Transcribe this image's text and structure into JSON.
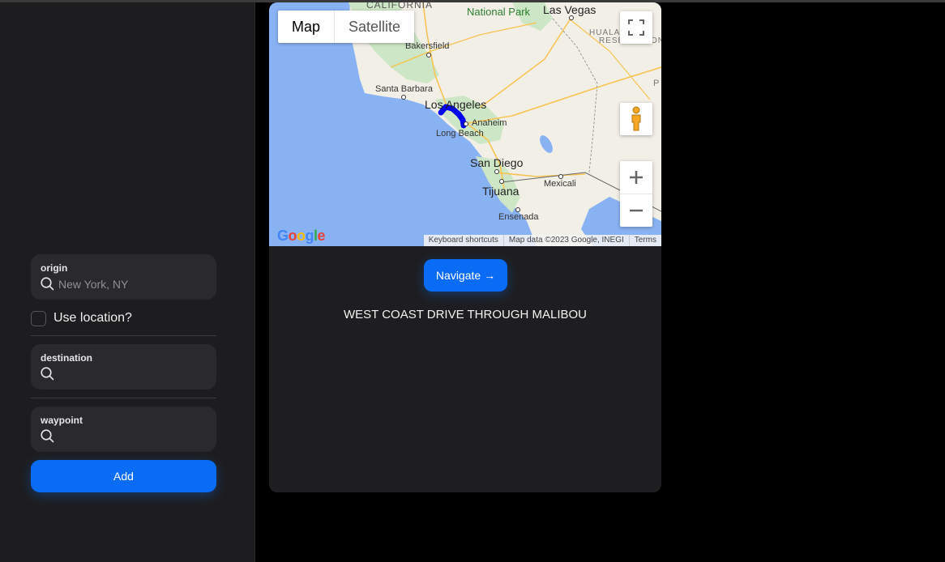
{
  "sidebar": {
    "origin": {
      "label": "origin",
      "placeholder": "New York, NY",
      "value": ""
    },
    "use_location": {
      "label": "Use location?",
      "checked": false
    },
    "destination": {
      "label": "destination",
      "placeholder": "",
      "value": ""
    },
    "waypoint": {
      "label": "waypoint",
      "placeholder": "",
      "value": ""
    },
    "add_label": "Add"
  },
  "map": {
    "type_tabs": [
      "Map",
      "Satellite"
    ],
    "active_tab": "Map",
    "cities": {
      "california": "CALIFORNIA",
      "national_park": "National Park",
      "las_vegas": "Las Vegas",
      "hualapai_line1": "HUALAPAI",
      "hualapai_line2": "RESERVATION",
      "bakersfield": "Bakersfield",
      "santa_barbara": "Santa Barbara",
      "los_angeles": "Los Angeles",
      "anaheim": "Anaheim",
      "long_beach": "Long Beach",
      "san_diego": "San Diego",
      "tijuana": "Tijuana",
      "mexicali": "Mexicali",
      "ensenada": "Ensenada",
      "p_edge": "P"
    },
    "logo": "Google",
    "attribution": [
      "Keyboard shortcuts",
      "Map data ©2023 Google, INEGI",
      "Terms"
    ],
    "icons": {
      "fullscreen": "fullscreen-icon",
      "pegman": "pegman-icon",
      "zoom_in": "zoom-in-icon",
      "zoom_out": "zoom-out-icon"
    },
    "colors": {
      "water": "#89b2f2",
      "land": "#f2efe6",
      "route": "#0000ee",
      "highway": "#f6c453"
    }
  },
  "navigate_label": "Navigate →",
  "route_title": "WEST COAST DRIVE THROUGH MALIBOU",
  "colors": {
    "accent": "#0a6cf5",
    "panel": "#1d1d1f",
    "card": "#1e1e20"
  }
}
